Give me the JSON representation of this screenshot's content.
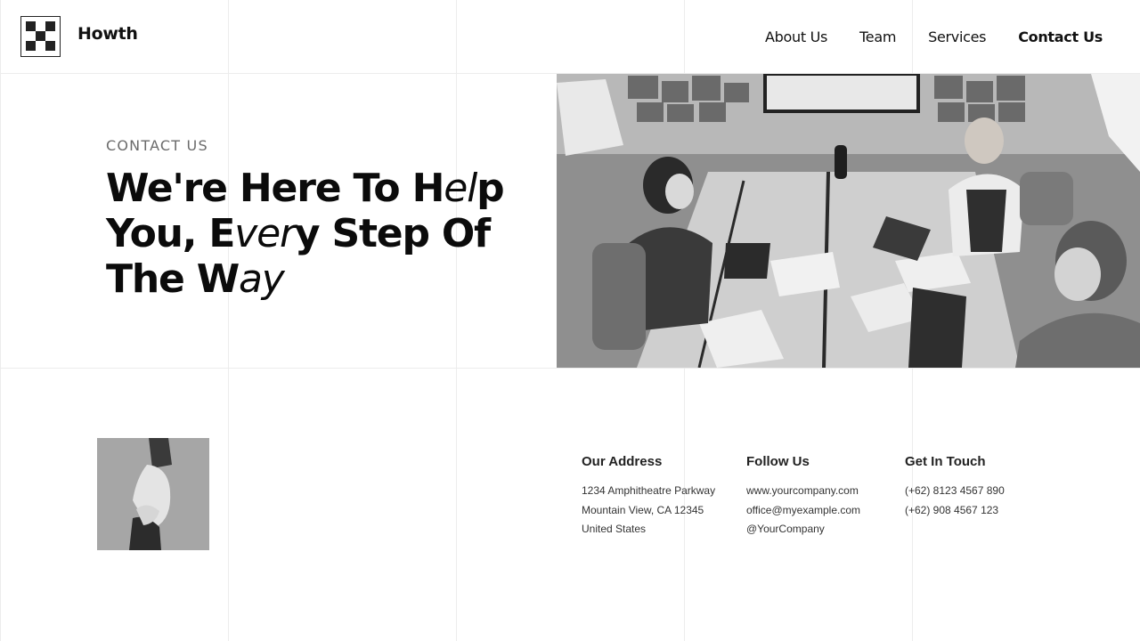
{
  "header": {
    "brand": "Howth",
    "nav": [
      {
        "label": "About Us"
      },
      {
        "label": "Team"
      },
      {
        "label": "Services"
      },
      {
        "label": "Contact Us"
      }
    ]
  },
  "hero": {
    "eyebrow": "CONTACT US",
    "headline": {
      "p1": "We're Here To H",
      "i1": "el",
      "p2": "p You, E",
      "i2": "ver",
      "p3": "y Step Of The W",
      "i3": "ay"
    }
  },
  "info": {
    "address": {
      "title": "Our Address",
      "lines": [
        "1234 Amphitheatre Parkway",
        "Mountain View, CA 12345",
        "United States"
      ]
    },
    "follow": {
      "title": "Follow Us",
      "lines": [
        "www.yourcompany.com",
        "office@myexample.com",
        "@YourCompany"
      ]
    },
    "touch": {
      "title": "Get In Touch",
      "lines": [
        "(+62) 8123 4567 890",
        "(+62) 908 4567 123"
      ]
    }
  },
  "colors": {
    "text": "#111111",
    "muted": "#6b6b6b",
    "grid": "#ececec",
    "background": "#ffffff"
  },
  "icons": {
    "logo": "checker-logo-icon"
  }
}
